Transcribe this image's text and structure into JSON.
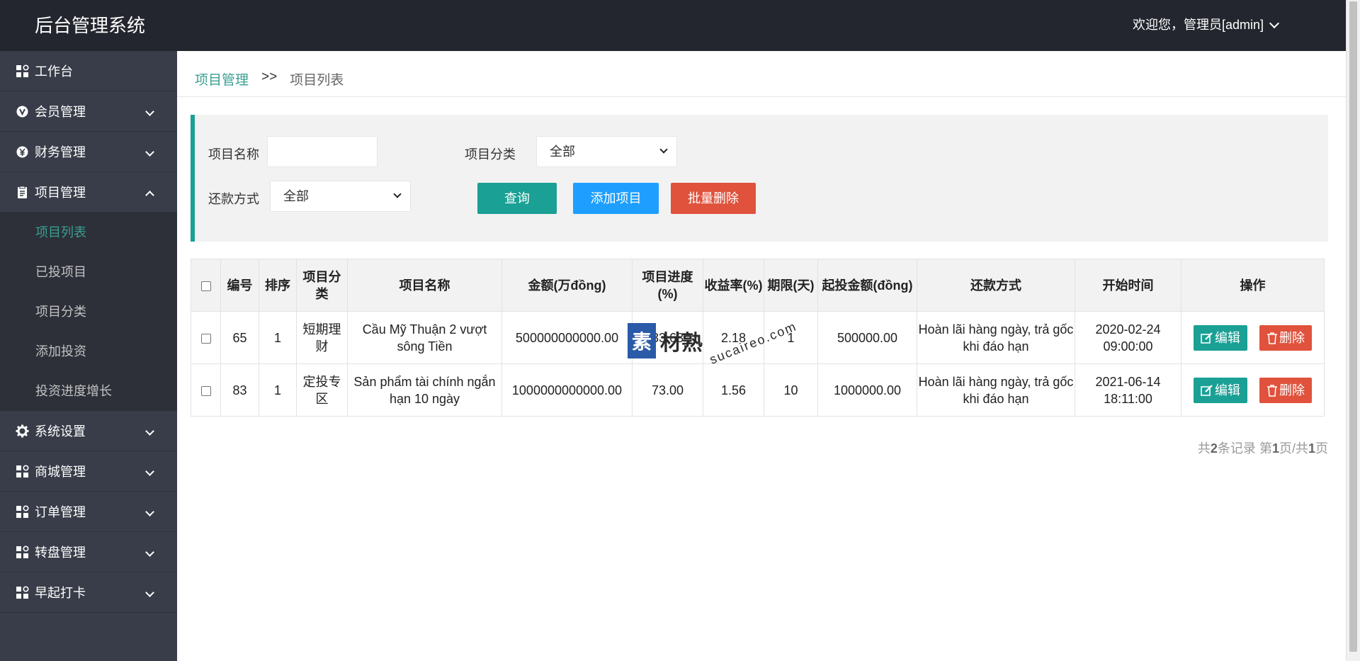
{
  "header": {
    "brand": "后台管理系统",
    "user": "欢迎您，管理员[admin]"
  },
  "sidebar": {
    "items": [
      {
        "label": "工作台",
        "icon": "dashboard-icon"
      },
      {
        "label": "会员管理",
        "icon": "vip-icon"
      },
      {
        "label": "财务管理",
        "icon": "yen-icon"
      },
      {
        "label": "项目管理",
        "icon": "clipboard-icon"
      },
      {
        "label": "系统设置",
        "icon": "gear-icon"
      },
      {
        "label": "商城管理",
        "icon": "dashboard-icon"
      },
      {
        "label": "订单管理",
        "icon": "dashboard-icon"
      },
      {
        "label": "转盘管理",
        "icon": "dashboard-icon"
      },
      {
        "label": "早起打卡",
        "icon": "dashboard-icon"
      }
    ],
    "sub_items": [
      "项目列表",
      "已投项目",
      "项目分类",
      "添加投资",
      "投资进度增长"
    ],
    "active_sub": "项目列表"
  },
  "breadcrumb": {
    "parent": "项目管理",
    "separator": ">>",
    "current": "项目列表"
  },
  "filter": {
    "name_label": "项目名称",
    "name_value": "",
    "category_label": "项目分类",
    "category_value": "全部",
    "repay_label": "还款方式",
    "repay_value": "全部",
    "search_button": "查询",
    "add_button": "添加项目",
    "batch_delete_button": "批量删除"
  },
  "table": {
    "headers": [
      "编号",
      "排序",
      "项目分类",
      "项目名称",
      "金额(万đồng)",
      "项目进度(%)",
      "收益率(%)",
      "期限(天)",
      "起投金额(đồng)",
      "还款方式",
      "开始时间",
      "操作"
    ],
    "rows": [
      {
        "id": "65",
        "sort": "1",
        "category": "短期理财",
        "name": "Cầu Mỹ Thuận 2 vượt sông Tiền",
        "amount": "500000000000.00",
        "progress": "33.68",
        "rate": "2.18",
        "term": "1",
        "min_invest": "500000.00",
        "repay": "Hoàn lãi hàng ngày, trả gốc khi đáo hạn",
        "start_date": "2020-02-24",
        "start_time": "09:00:00"
      },
      {
        "id": "83",
        "sort": "1",
        "category": "定投专区",
        "name": "Sản phẩm tài chính ngắn hạn 10 ngày",
        "amount": "1000000000000.00",
        "progress": "73.00",
        "rate": "1.56",
        "term": "10",
        "min_invest": "1000000.00",
        "repay": "Hoàn lãi hàng ngày, trả gốc khi đáo hạn",
        "start_date": "2021-06-14",
        "start_time": "18:11:00"
      }
    ],
    "edit_label": "编辑",
    "delete_label": "删除"
  },
  "pager": {
    "prefix": "共",
    "total": "2",
    "mid1": "条记录 第",
    "page": "1",
    "mid2": "页/共",
    "pages": "1",
    "suffix": "页"
  },
  "watermark": {
    "logo": "素",
    "text": "材熟",
    "url": "sucaireo.com"
  },
  "colors": {
    "header_bg": "#23262e",
    "sidebar_bg": "#393d49",
    "accent": "#1aa094",
    "add_button": "#1e9fff",
    "danger": "#e0523c"
  }
}
